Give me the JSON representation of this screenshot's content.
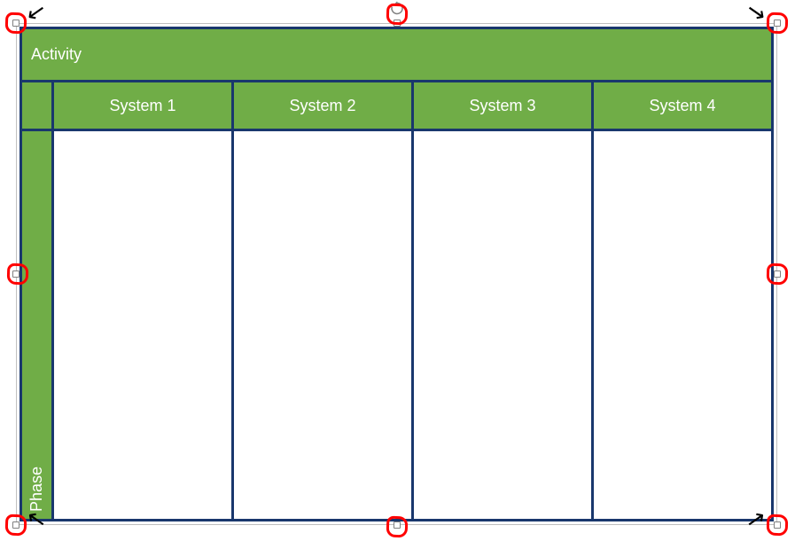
{
  "title": "Activity",
  "phase_label": "Phase",
  "columns": [
    "System 1",
    "System 2",
    "System 3",
    "System 4"
  ],
  "colors": {
    "border": "#19376d",
    "fill": "#70ad47",
    "annotation": "#ff0000"
  }
}
